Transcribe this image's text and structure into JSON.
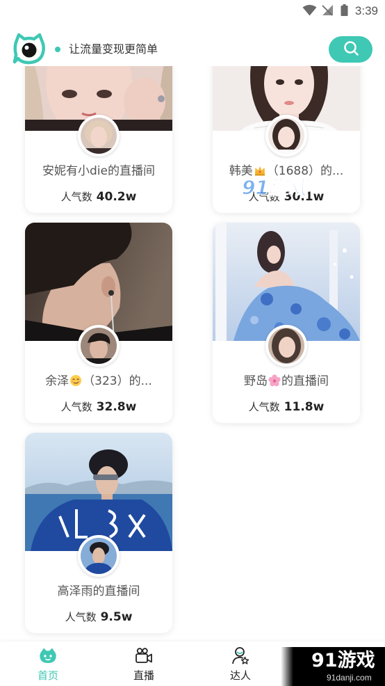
{
  "status_bar": {
    "time": "3:39",
    "icons": [
      "wifi-icon",
      "no-sim-icon",
      "battery-icon"
    ]
  },
  "header": {
    "logo": "cat-eye-logo",
    "slogan": "让流量变现更简单",
    "search_icon": "search-icon"
  },
  "colors": {
    "accent": "#3fc8b4",
    "text_primary": "#222222",
    "text_secondary": "#555555",
    "card_background": "#ffffff"
  },
  "rooms": [
    {
      "name": "安妮有小die的直播间",
      "popularity_label": "人气数",
      "popularity": "40.2w"
    },
    {
      "name_before": "韩美",
      "name_emoji": "crown-emoji",
      "name_after": "（1688）的...",
      "popularity_label": "人气数",
      "popularity": "30.1w"
    },
    {
      "name_before": "余泽",
      "name_emoji": "smirk-face-emoji",
      "name_after": "（323）的...",
      "popularity_label": "人气数",
      "popularity": "32.8w"
    },
    {
      "name_before": "野岛",
      "name_emoji": "cherry-blossom-emoji",
      "name_after": "的直播间",
      "popularity_label": "人气数",
      "popularity": "11.8w"
    },
    {
      "name": "高泽雨的直播间",
      "popularity_label": "人气数",
      "popularity": "9.5w"
    }
  ],
  "bottom_nav": {
    "items": [
      {
        "label": "首页",
        "icon": "home-icon",
        "active": true
      },
      {
        "label": "直播",
        "icon": "video-camera-icon",
        "active": false
      },
      {
        "label": "达人",
        "icon": "talent-star-icon",
        "active": false
      },
      {
        "icon": "profile-icon",
        "active": false
      }
    ]
  },
  "watermark": {
    "center_text": "91游戏",
    "corner_title": "91游戏",
    "corner_url": "91danji.com"
  }
}
